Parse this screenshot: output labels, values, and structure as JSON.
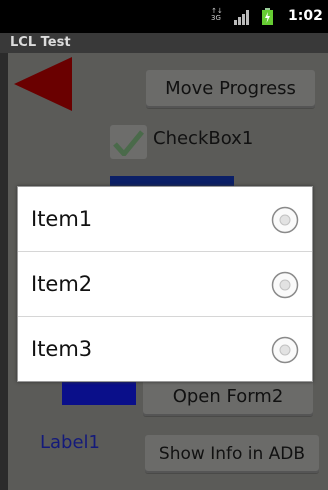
{
  "status_bar": {
    "network_label": "3G",
    "time": "1:02"
  },
  "title_bar": {
    "title": "LCL Test"
  },
  "form": {
    "move_progress_label": "Move Progress",
    "checkbox_label": "CheckBox1",
    "open_form2_label": "Open Form2",
    "show_info_label": "Show Info in ADB",
    "label1": "Label1",
    "triangle_color": "#b10000",
    "blue_color": "#0a0f8a"
  },
  "dialog": {
    "items": [
      {
        "label": "Item1",
        "selected": false
      },
      {
        "label": "Item2",
        "selected": false
      },
      {
        "label": "Item3",
        "selected": false
      }
    ]
  }
}
